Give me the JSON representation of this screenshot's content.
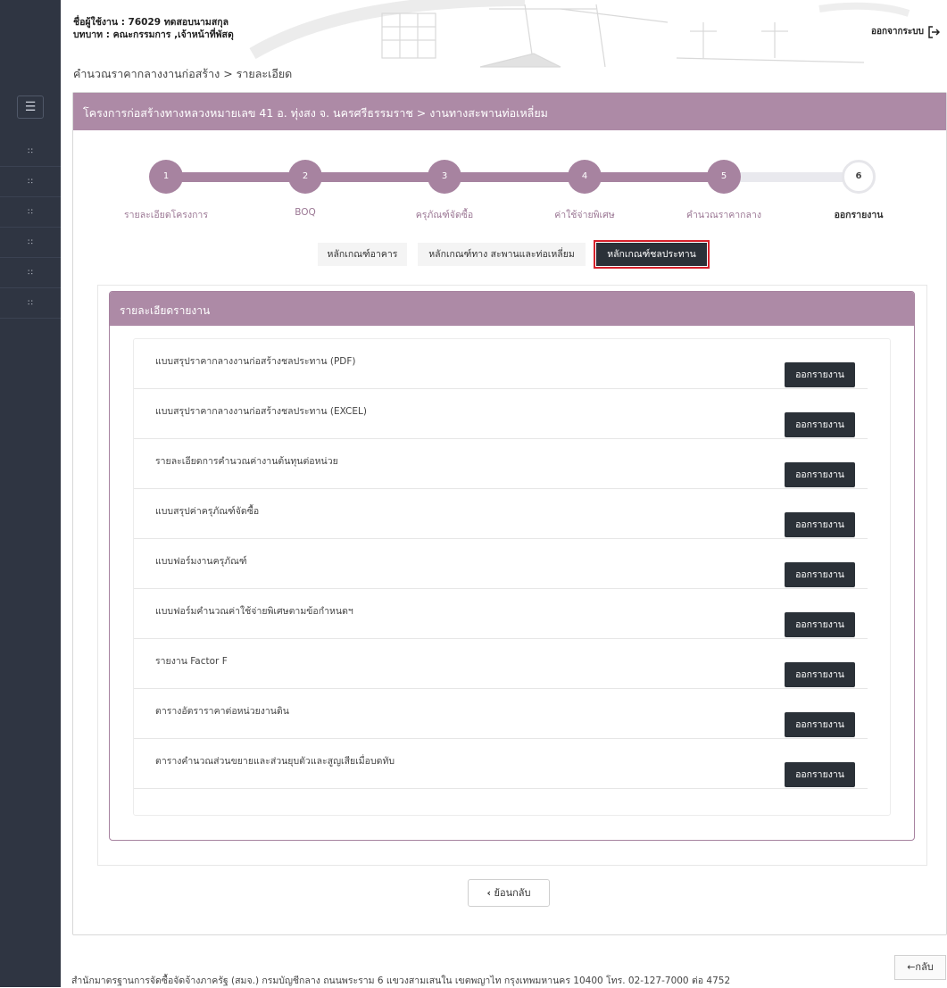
{
  "header": {
    "user_line": "ชื่อผู้ใช้งาน : 76029 ทดสอบนามสกุล",
    "role_line": "บทบาท : คณะกรรมการ ,เจ้าหน้าที่พัสดุ",
    "logout_label": "ออกจากระบบ",
    "breadcrumb": "คำนวณราคากลางงานก่อสร้าง > รายละเอียด"
  },
  "sidebar": {
    "toggle_icon": "hamburger-icon",
    "items": [
      "grid-icon",
      "grid-icon",
      "grid-icon",
      "grid-icon",
      "grid-icon",
      "grid-icon"
    ]
  },
  "project": {
    "title": "โครงการก่อสร้างทางหลวงหมายเลข 41 อ. ทุ่งสง จ. นครศรีธรรมราช > งานทางสะพานท่อเหลี่ยม"
  },
  "stepper": {
    "steps": [
      {
        "number": "1",
        "label": "รายละเอียดโครงการ"
      },
      {
        "number": "2",
        "label": "BOQ"
      },
      {
        "number": "3",
        "label": "ครุภัณฑ์จัดซื้อ"
      },
      {
        "number": "4",
        "label": "ค่าใช้จ่ายพิเศษ"
      },
      {
        "number": "5",
        "label": "คำนวณราคากลาง"
      },
      {
        "number": "6",
        "label": "ออกรายงาน"
      }
    ],
    "active_step": 6
  },
  "tabs": [
    {
      "label": "หลักเกณฑ์อาคาร"
    },
    {
      "label": "หลักเกณฑ์ทาง สะพานและท่อเหลี่ยม"
    },
    {
      "label": "หลักเกณฑ์ชลประทาน"
    }
  ],
  "active_tab": 2,
  "report_panel": {
    "title": "รายละเอียดรายงาน",
    "button_label": "ออกรายงาน",
    "reports": [
      "แบบสรุปราคากลางงานก่อสร้างชลประทาน (PDF)",
      "แบบสรุปราคากลางงานก่อสร้างชลประทาน (EXCEL)",
      "รายละเอียดการคำนวณค่างานต้นทุนต่อหน่วย",
      "แบบสรุปค่าครุภัณฑ์จัดซื้อ",
      "แบบฟอร์มงานครุภัณฑ์",
      "แบบฟอร์มคำนวณค่าใช้จ่ายพิเศษตามข้อกำหนดฯ",
      "รายงาน Factor F",
      "ตารางอัตราราคาต่อหน่วยงานดิน",
      "ตารางคำนวณส่วนขยายและส่วนยุบตัวและสูญเสียเมื่อบดทับ"
    ]
  },
  "back_button_label": "ย้อนกลับ",
  "back_link_label": "←กลับ",
  "footer": "สำนักมาตรฐานการจัดซื้อจัดจ้างภาครัฐ (สมจ.) กรมบัญชีกลาง ถนนพระราม 6 แขวงสามเสนใน เขตพญาไท กรุงเทพมหานคร 10400 โทร. 02-127-7000 ต่อ 4752",
  "colors": {
    "accent": "#ad8aa6",
    "sidebar": "#2f3542",
    "button": "#2b3138",
    "highlight": "#d6212b"
  }
}
